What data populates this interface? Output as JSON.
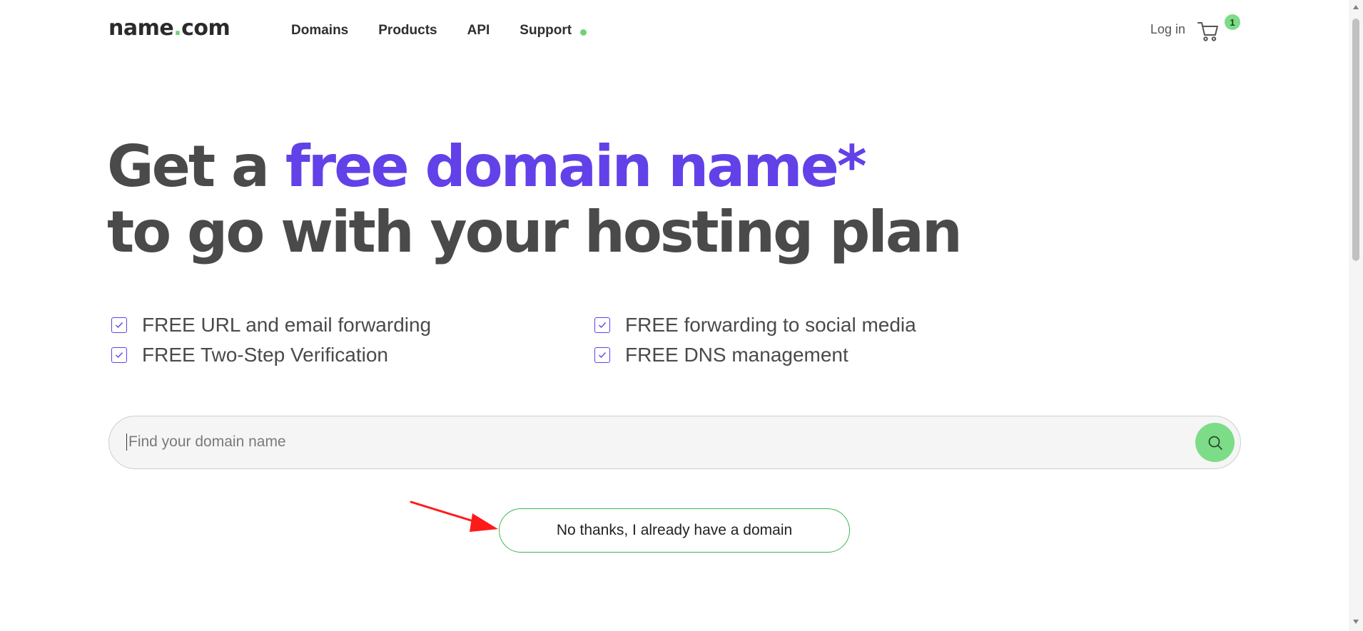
{
  "header": {
    "logo": {
      "name": "name",
      "dot": ".",
      "tld": "com"
    },
    "nav": [
      {
        "label": "Domains"
      },
      {
        "label": "Products"
      },
      {
        "label": "API"
      },
      {
        "label": "Support"
      }
    ],
    "login_label": "Log in",
    "cart_count": "1",
    "cart_icon": "cart-icon"
  },
  "hero": {
    "line1_prefix": "Get a ",
    "line1_accent": "free domain name*",
    "line2": "to go with your hosting plan"
  },
  "features": [
    {
      "label": "FREE URL and email forwarding"
    },
    {
      "label": "FREE forwarding to social media"
    },
    {
      "label": "FREE Two-Step Verification"
    },
    {
      "label": "FREE DNS management"
    }
  ],
  "search": {
    "placeholder": "Find your domain name",
    "value": "",
    "button_icon": "search-icon"
  },
  "no_thanks_label": "No thanks, I already have a domain",
  "colors": {
    "accent_purple": "#6241e8",
    "accent_green": "#7ddc87",
    "text_dark": "#4a4a4a",
    "annotation_arrow": "#ff1a1a"
  }
}
